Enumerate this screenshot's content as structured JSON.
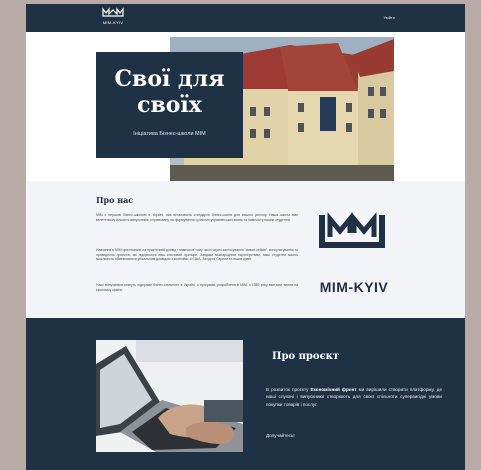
{
  "header": {
    "logo_text": "MIM-KYIV",
    "nav_link": "Увійти"
  },
  "hero": {
    "title": "Свої для своїх",
    "subtitle": "Ініціатива Бізнес-школи МІМ"
  },
  "about": {
    "title": "Про нас",
    "paragraphs": [
      "МІМ є першою бізнес-школою в Україні, яка встановила стандарти бізнес-освіти для вашого регіону. Наша школа має велетенську кількість випускників, спрямовану на формування сучасних управлінських знань та навичок у наших студентів.",
      "Навчання в МІМ орієнтоване на практичний досвід і навички в тому числі через застосування \"живих кейсів\", консультування та проведення проектів, які підкреслює наш ключовий принцип. Завдяки міжнародним партнерствам, наші студенти мають можливість обмінюватися унікальним досвідом з колегами зі США, Західної Європи та інших країн.",
      "Наші випускники стануть лідерами бізнес-спільноти в Україні, а програма, розроблена в МІМ, з 1989 року вже має вплив на економіку країни."
    ],
    "logo_text": "MIM-KYIV"
  },
  "project": {
    "title": "Про проєкт",
    "text_before": "В розвиток проєкту ",
    "text_highlight": "Економічний фронт",
    "text_after": " ми вирішили створити платформу, де наші слухачі і випускники створюють для своєї спільноти супервигідні умови покупки товарів і послуг.",
    "cta": "Долучайтесь!"
  },
  "colors": {
    "navy": "#1f3145",
    "background": "#b9aca8",
    "light_section": "#f2f4f7"
  }
}
